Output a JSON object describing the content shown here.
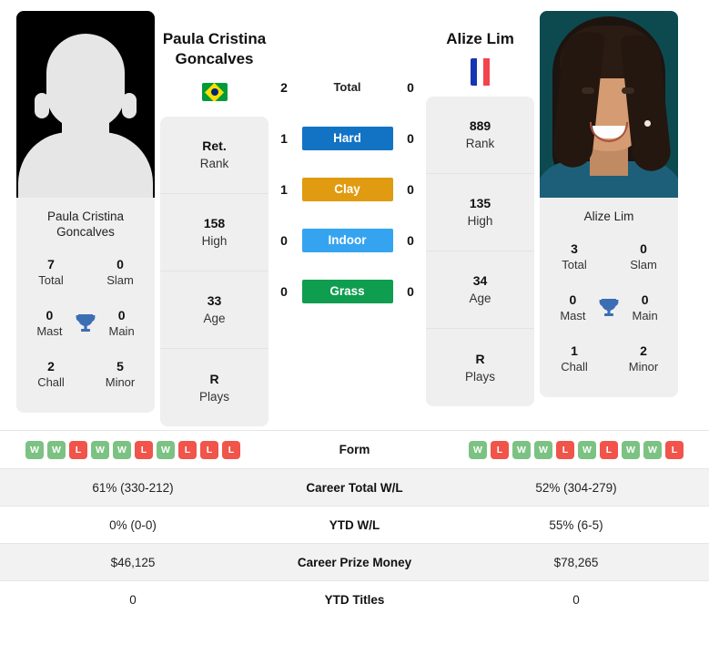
{
  "players": {
    "left": {
      "name": "Paula Cristina Goncalves",
      "name_line1": "Paula Cristina",
      "name_line2": "Goncalves",
      "country": "Brazil",
      "flag_icon": "flag-brazil-icon",
      "photo_type": "placeholder-silhouette",
      "titles": {
        "total_value": "7",
        "total_label": "Total",
        "slam_value": "0",
        "slam_label": "Slam",
        "mast_value": "0",
        "mast_label": "Mast",
        "main_value": "0",
        "main_label": "Main",
        "chall_value": "2",
        "chall_label": "Chall",
        "minor_value": "5",
        "minor_label": "Minor"
      },
      "stats": [
        {
          "value": "Ret.",
          "label": "Rank"
        },
        {
          "value": "158",
          "label": "High"
        },
        {
          "value": "33",
          "label": "Age"
        },
        {
          "value": "R",
          "label": "Plays"
        }
      ],
      "form": [
        "W",
        "W",
        "L",
        "W",
        "W",
        "L",
        "W",
        "L",
        "L",
        "L"
      ],
      "career_total_wl": "61% (330-212)",
      "ytd_wl": "0% (0-0)",
      "career_prize_money": "$46,125",
      "ytd_titles": "0"
    },
    "right": {
      "name": "Alize Lim",
      "name_line1": "Alize Lim",
      "name_line2": "",
      "country": "France",
      "flag_icon": "flag-france-icon",
      "photo_type": "portrait-photo",
      "titles": {
        "total_value": "3",
        "total_label": "Total",
        "slam_value": "0",
        "slam_label": "Slam",
        "mast_value": "0",
        "mast_label": "Mast",
        "main_value": "0",
        "main_label": "Main",
        "chall_value": "1",
        "chall_label": "Chall",
        "minor_value": "2",
        "minor_label": "Minor"
      },
      "stats": [
        {
          "value": "889",
          "label": "Rank"
        },
        {
          "value": "135",
          "label": "High"
        },
        {
          "value": "34",
          "label": "Age"
        },
        {
          "value": "R",
          "label": "Plays"
        }
      ],
      "form": [
        "W",
        "L",
        "W",
        "W",
        "L",
        "W",
        "L",
        "W",
        "W",
        "L"
      ],
      "career_total_wl": "52% (304-279)",
      "ytd_wl": "55% (6-5)",
      "career_prize_money": "$78,265",
      "ytd_titles": "0"
    }
  },
  "head_to_head": [
    {
      "label": "Total",
      "left": "2",
      "right": "0",
      "bar": false,
      "color": ""
    },
    {
      "label": "Hard",
      "left": "1",
      "right": "0",
      "bar": true,
      "color": "#1273c4"
    },
    {
      "label": "Clay",
      "left": "1",
      "right": "0",
      "bar": true,
      "color": "#e09b10"
    },
    {
      "label": "Indoor",
      "left": "0",
      "right": "0",
      "bar": true,
      "color": "#35a4f0"
    },
    {
      "label": "Grass",
      "left": "0",
      "right": "0",
      "bar": true,
      "color": "#0f9d4f"
    }
  ],
  "comparison_rows": [
    {
      "label": "Form"
    },
    {
      "label": "Career Total W/L"
    },
    {
      "label": "YTD W/L"
    },
    {
      "label": "Career Prize Money"
    },
    {
      "label": "YTD Titles"
    }
  ],
  "icons": {
    "trophy": "trophy-icon"
  },
  "colors": {
    "win": "#7cc283",
    "loss": "#f0544a",
    "hard": "#1273c4",
    "clay": "#e09b10",
    "indoor": "#35a4f0",
    "grass": "#0f9d4f",
    "trophy": "#3c6eb4",
    "card_bg": "#efefef",
    "row_shade": "#f2f2f2"
  }
}
